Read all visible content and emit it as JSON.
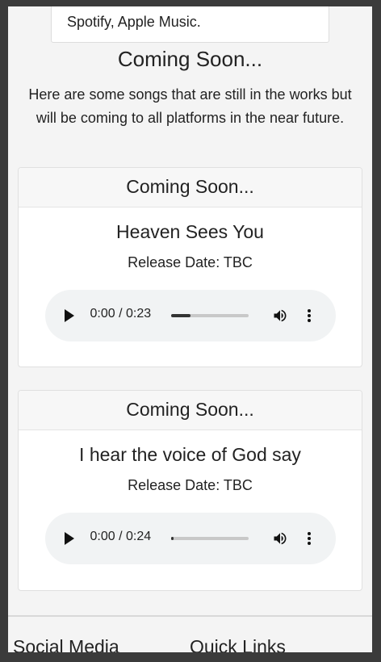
{
  "top_card": {
    "text": "Spotify, Apple Music."
  },
  "coming_soon": {
    "title": "Coming Soon...",
    "description": "Here are some songs that are still in the works but will be coming to all platforms in the near future."
  },
  "songs": [
    {
      "header": "Coming Soon...",
      "title": "Heaven Sees You",
      "release": "Release Date: TBC",
      "time": "0:00 / 0:23",
      "progress": 0.26
    },
    {
      "header": "Coming Soon...",
      "title": "I hear the voice of God say",
      "release": "Release Date: TBC",
      "time": "0:00 / 0:24",
      "progress": 0.04
    }
  ],
  "footer": {
    "social_title": "Social Media",
    "links_title": "Quick Links"
  }
}
